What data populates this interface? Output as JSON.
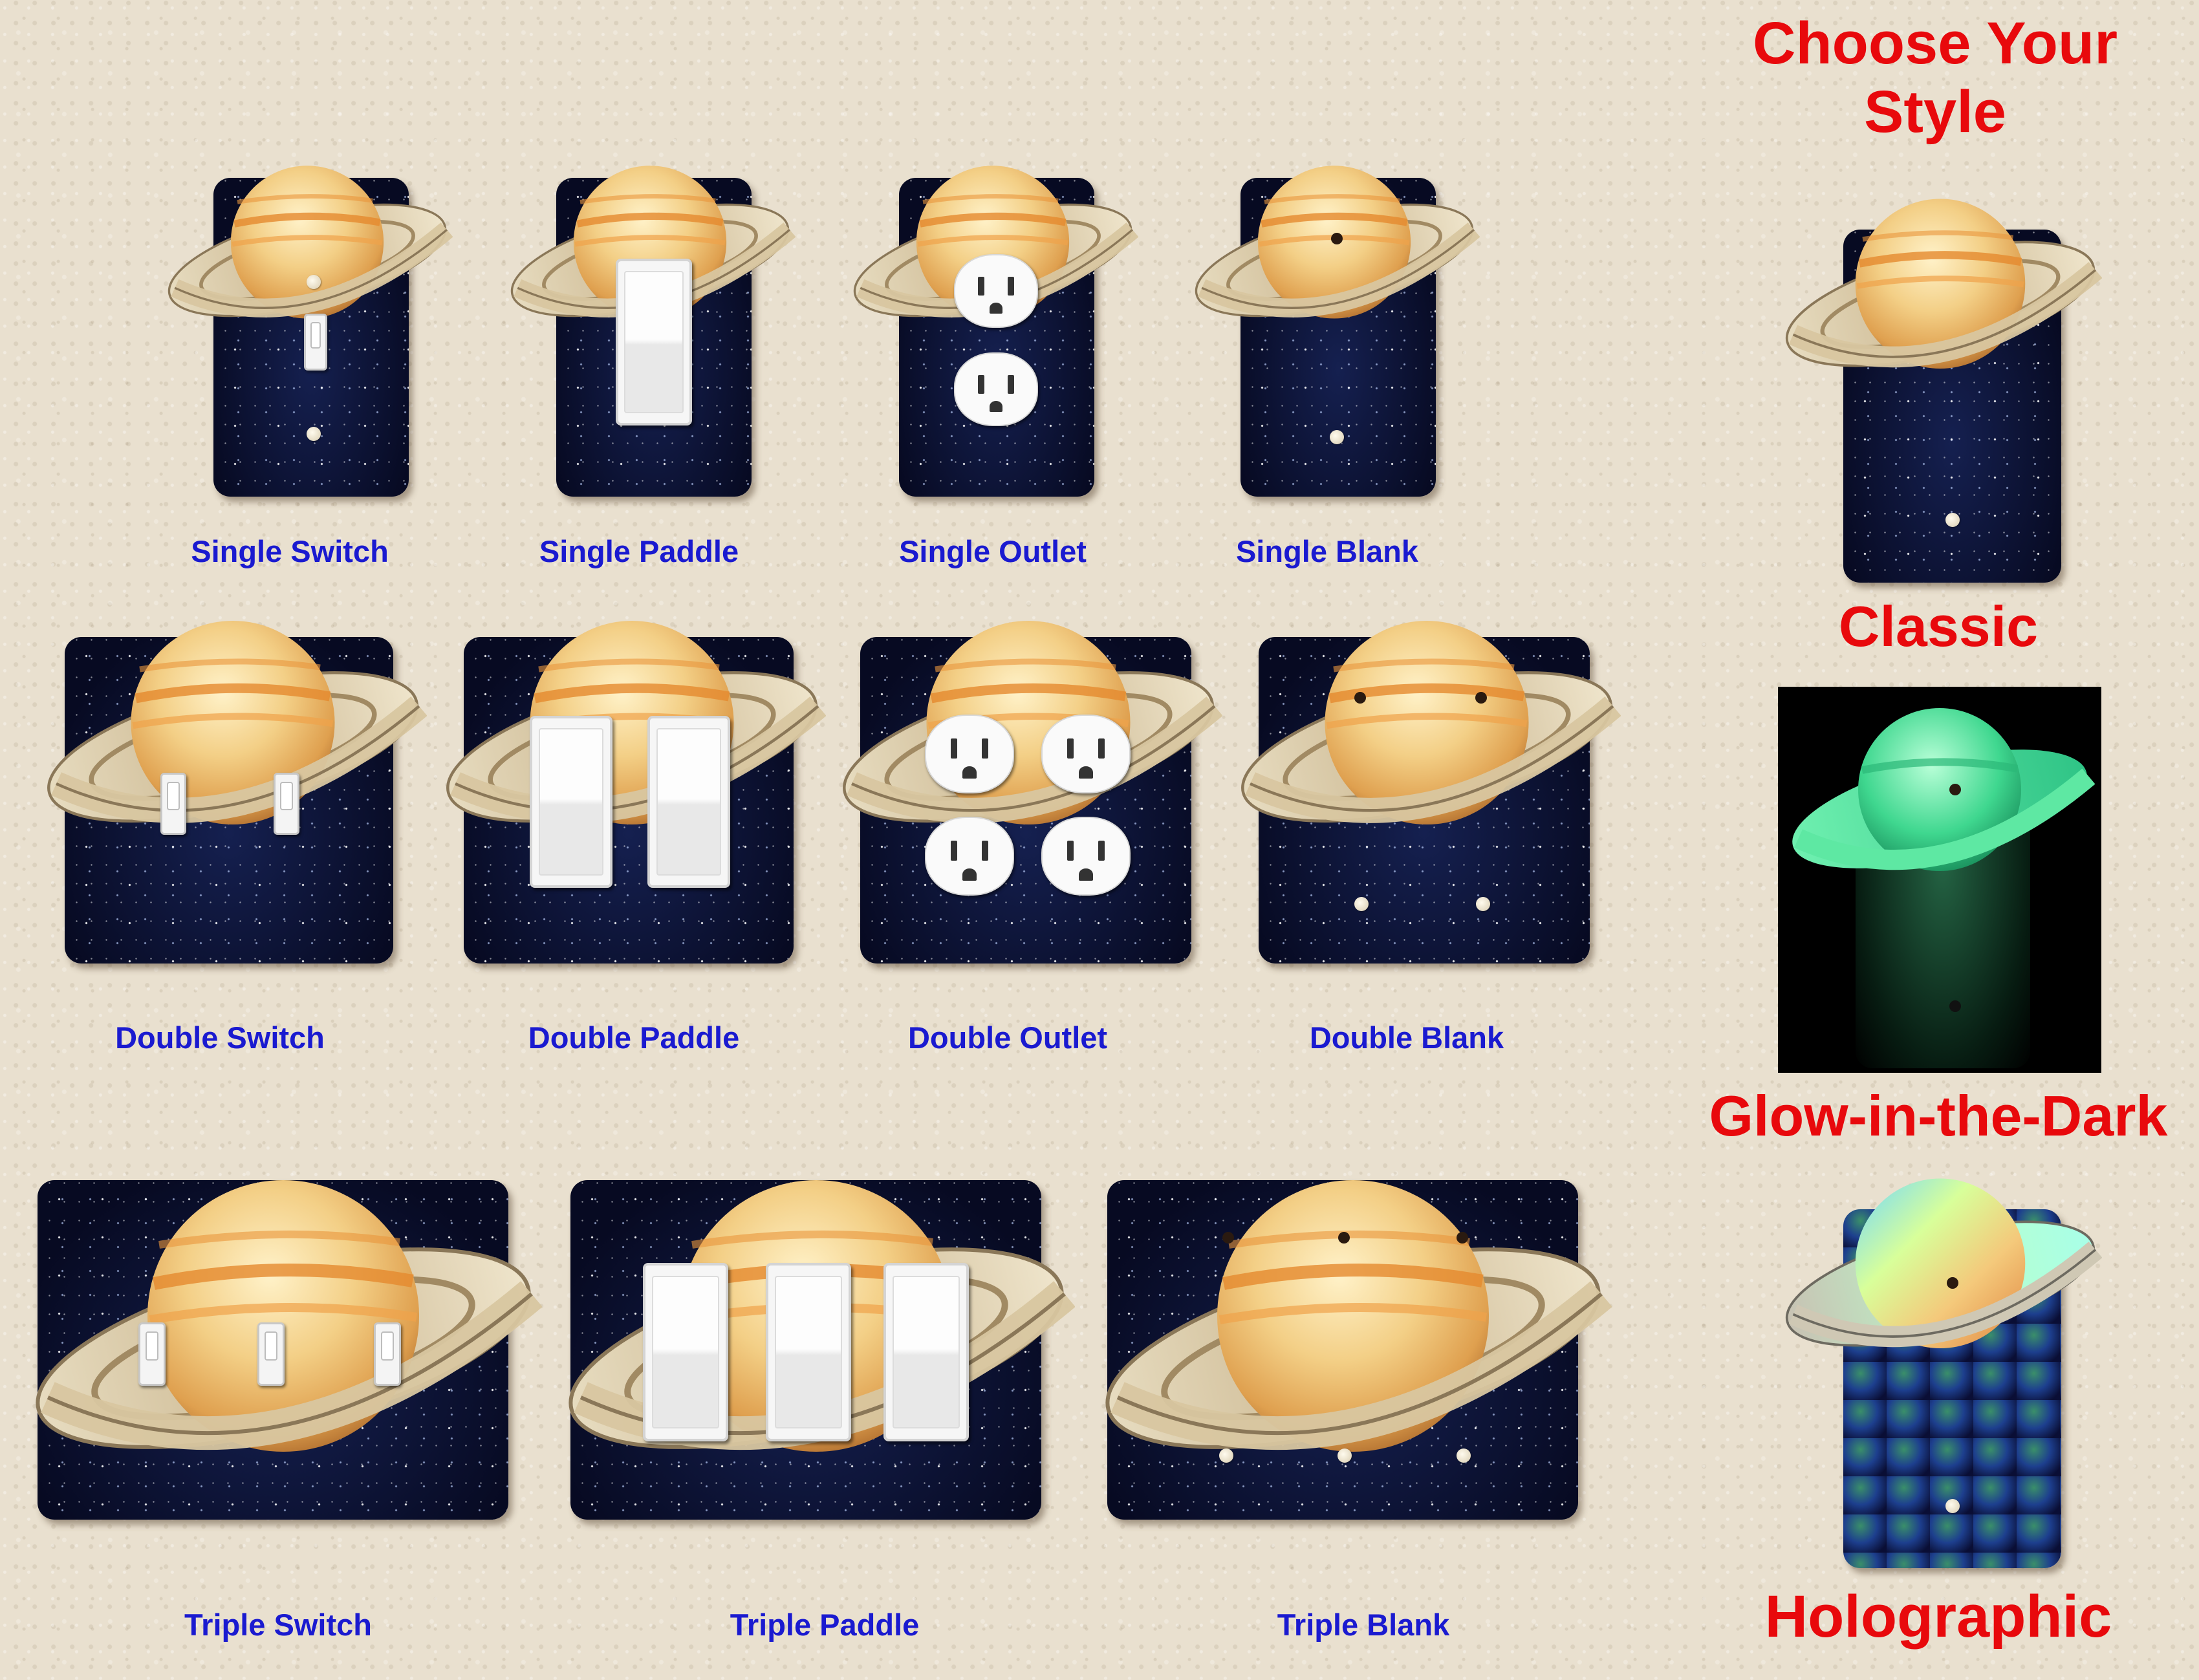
{
  "heading": {
    "line1": "Choose Your",
    "line2": "Style"
  },
  "styles": {
    "classic": "Classic",
    "glow": "Glow-in-the-Dark",
    "holographic": "Holographic"
  },
  "products": {
    "single_switch": "Single Switch",
    "single_paddle": "Single Paddle",
    "single_outlet": "Single Outlet",
    "single_blank": "Single Blank",
    "double_switch": "Double Switch",
    "double_paddle": "Double Paddle",
    "double_outlet": "Double Outlet",
    "double_blank": "Double Blank",
    "triple_switch": "Triple Switch",
    "triple_paddle": "Triple Paddle",
    "triple_blank": "Triple Blank"
  },
  "colors": {
    "caption": "#1a1ad0",
    "heading": "#e8090c",
    "space": "#0b0f2c",
    "wall": "#e9e0cf"
  },
  "icons": {
    "planet": "saturn-icon"
  }
}
